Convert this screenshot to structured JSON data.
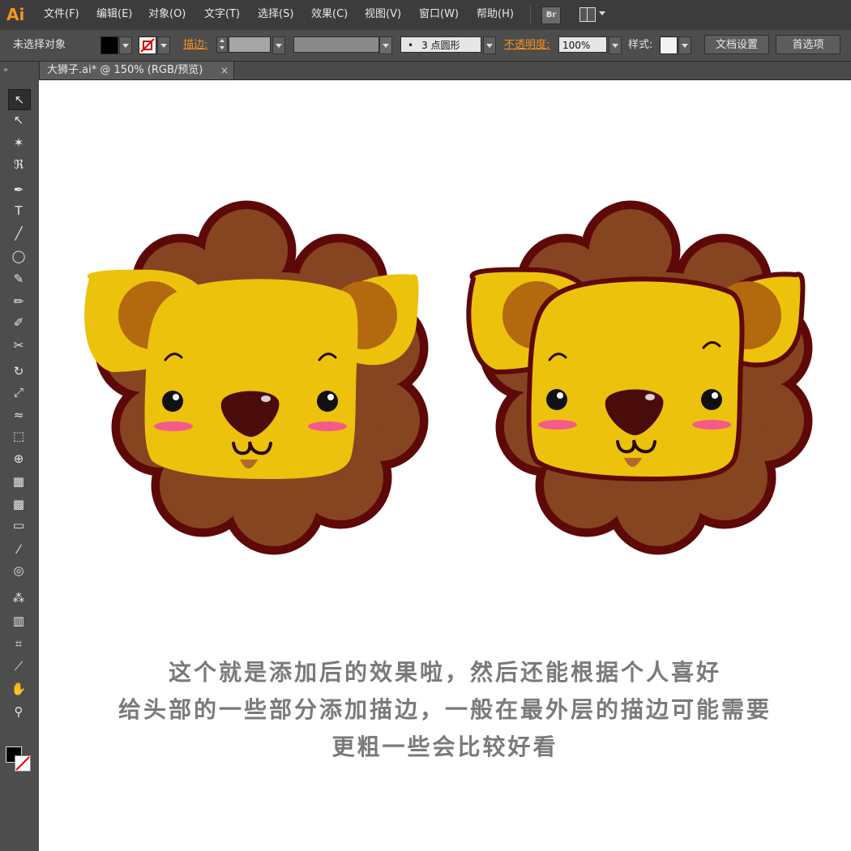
{
  "app": {
    "logo": "Ai"
  },
  "menu": [
    {
      "label": "文件(F)"
    },
    {
      "label": "编辑(E)"
    },
    {
      "label": "对象(O)"
    },
    {
      "label": "文字(T)"
    },
    {
      "label": "选择(S)"
    },
    {
      "label": "效果(C)"
    },
    {
      "label": "视图(V)"
    },
    {
      "label": "窗口(W)"
    },
    {
      "label": "帮助(H)"
    }
  ],
  "menu_buttons": {
    "bridge": "Br",
    "arrange_icon": "arrange-documents-icon"
  },
  "control": {
    "selection_status": "未选择对象",
    "fill_color": "#000000",
    "stroke_color": "none",
    "stroke_label": "描边:",
    "stroke_weight": "",
    "variable_width": "",
    "brush_label": "3 点圆形",
    "brush_dot": "•",
    "opacity_label": "不透明度:",
    "opacity_value": "100%",
    "style_label": "样式:",
    "doc_setup_button": "文档设置",
    "preferences_button": "首选项"
  },
  "tab": {
    "title": "大狮子.ai* @ 150% (RGB/预览)",
    "close": "×",
    "panel_collapse": "»"
  },
  "tools": [
    {
      "icon": "selection-tool-icon",
      "glyph": "↖",
      "active": true
    },
    {
      "icon": "direct-selection-tool-icon",
      "glyph": "↖"
    },
    {
      "icon": "magic-wand-tool-icon",
      "glyph": "✶"
    },
    {
      "icon": "lasso-tool-icon",
      "glyph": "ℜ"
    },
    {
      "icon": "pen-tool-icon",
      "glyph": "✒"
    },
    {
      "icon": "type-tool-icon",
      "glyph": "T"
    },
    {
      "icon": "line-segment-tool-icon",
      "glyph": "╱"
    },
    {
      "icon": "ellipse-tool-icon",
      "glyph": "◯"
    },
    {
      "icon": "paintbrush-tool-icon",
      "glyph": "✎"
    },
    {
      "icon": "pencil-tool-icon",
      "glyph": "✏"
    },
    {
      "icon": "blob-brush-tool-icon",
      "glyph": "✐"
    },
    {
      "icon": "scissors-tool-icon",
      "glyph": "✂"
    },
    {
      "icon": "rotate-tool-icon",
      "glyph": "↻"
    },
    {
      "icon": "scale-tool-icon",
      "glyph": "⤢"
    },
    {
      "icon": "warp-tool-icon",
      "glyph": "≈"
    },
    {
      "icon": "free-transform-tool-icon",
      "glyph": "⬚"
    },
    {
      "icon": "shape-builder-tool-icon",
      "glyph": "⊕"
    },
    {
      "icon": "perspective-grid-tool-icon",
      "glyph": "▦"
    },
    {
      "icon": "mesh-tool-icon",
      "glyph": "▩"
    },
    {
      "icon": "gradient-tool-icon",
      "glyph": "▭"
    },
    {
      "icon": "eyedropper-tool-icon",
      "glyph": "⁄"
    },
    {
      "icon": "blend-tool-icon",
      "glyph": "◎"
    },
    {
      "icon": "symbol-sprayer-tool-icon",
      "glyph": "⁂"
    },
    {
      "icon": "column-graph-tool-icon",
      "glyph": "▥"
    },
    {
      "icon": "artboard-tool-icon",
      "glyph": "⌗"
    },
    {
      "icon": "slice-tool-icon",
      "glyph": "⟋"
    },
    {
      "icon": "hand-tool-icon",
      "glyph": "✋"
    },
    {
      "icon": "zoom-tool-icon",
      "glyph": "⚲"
    }
  ],
  "canvas": {
    "caption_lines": [
      "这个就是添加后的效果啦，然后还能根据个人喜好",
      "给头部的一些部分添加描边，一般在最外层的描边可能需要",
      "更粗一些会比较好看"
    ]
  },
  "colors": {
    "mane": "#874420",
    "mane_outline": "#5e0808",
    "face": "#ecc20c",
    "ear_inner": "#b3690e",
    "nose": "#4a0b0b",
    "blush": "#f45a8c",
    "tongue": "#b06a2c"
  }
}
